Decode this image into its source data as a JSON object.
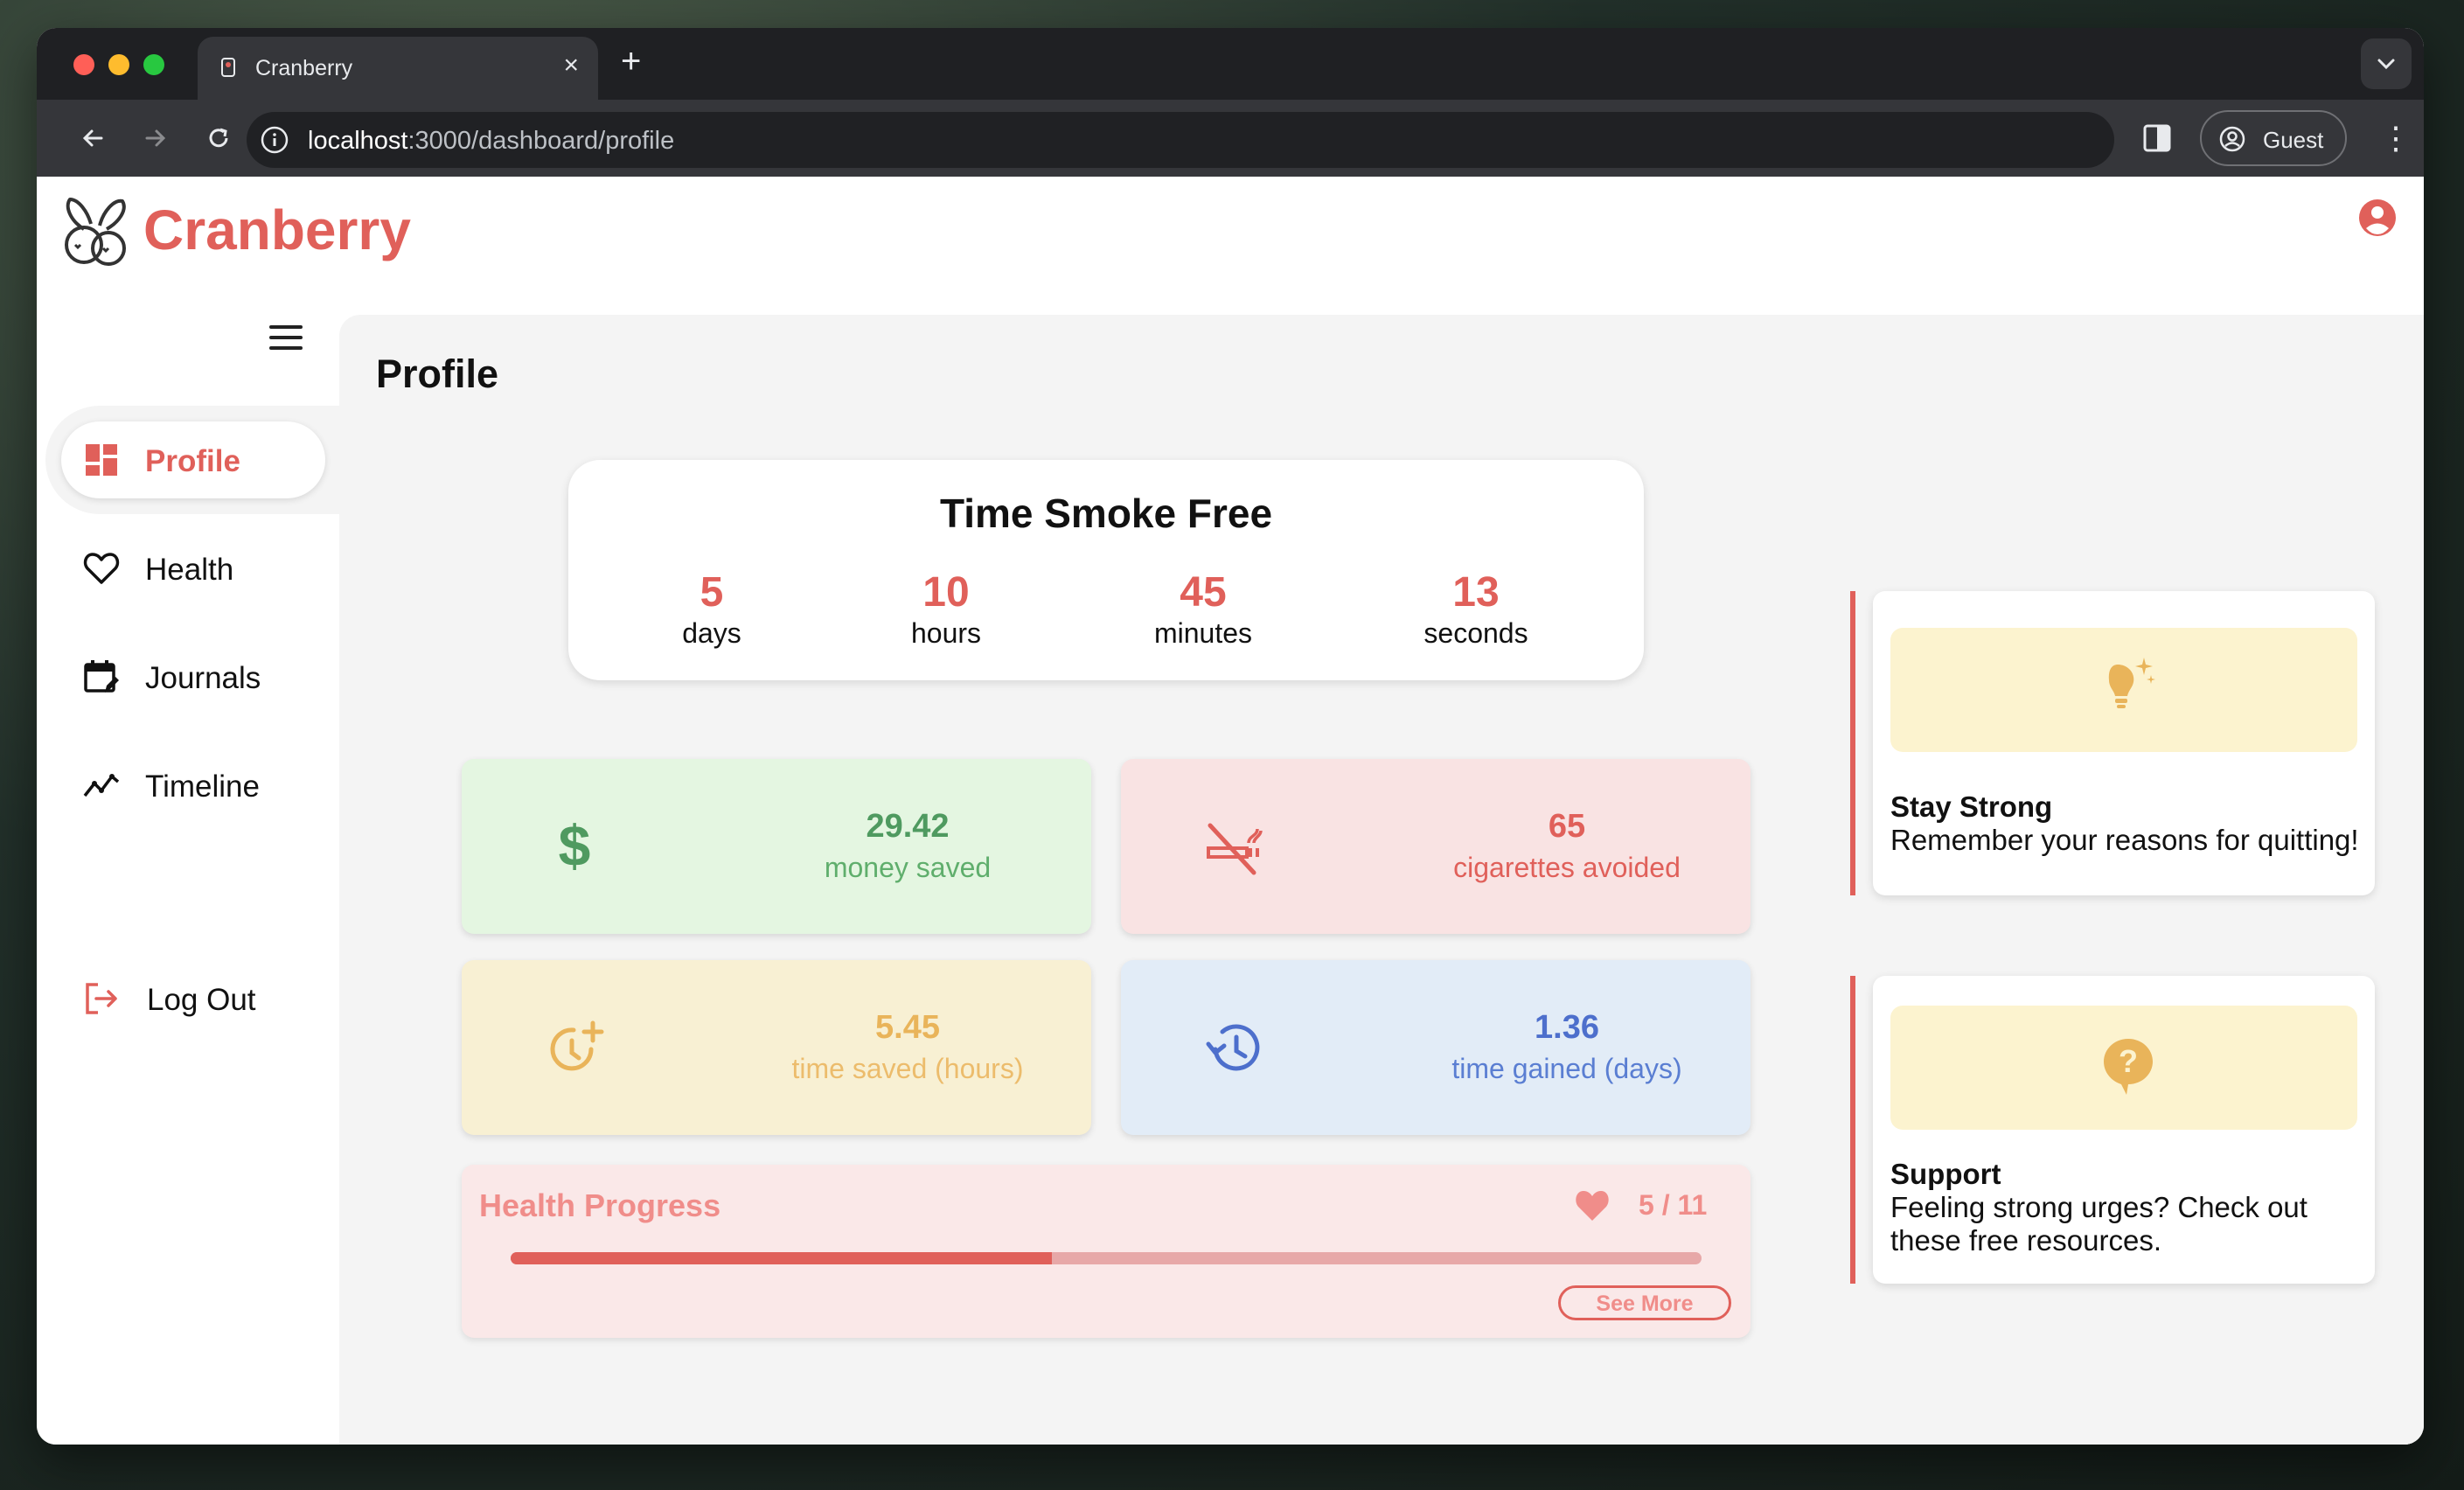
{
  "browser": {
    "tab_title": "Cranberry",
    "url_host": "localhost",
    "url_path": ":3000/dashboard/profile",
    "profile_label": "Guest"
  },
  "app": {
    "brand": "Cranberry",
    "accent_color": "#e0605a"
  },
  "sidebar": {
    "items": [
      {
        "label": "Profile",
        "icon": "dashboard-icon",
        "active": true
      },
      {
        "label": "Health",
        "icon": "heart-icon"
      },
      {
        "label": "Journals",
        "icon": "calendar-edit-icon"
      },
      {
        "label": "Timeline",
        "icon": "trend-line-icon"
      }
    ],
    "logout_label": "Log Out"
  },
  "main": {
    "page_title": "Profile",
    "time_smoke_free": {
      "title": "Time Smoke Free",
      "units": [
        {
          "value": "5",
          "label": "days"
        },
        {
          "value": "10",
          "label": "hours"
        },
        {
          "value": "45",
          "label": "minutes"
        },
        {
          "value": "13",
          "label": "seconds"
        }
      ]
    },
    "stats": [
      {
        "value": "29.42",
        "label": "money saved",
        "icon": "dollar-icon",
        "color": "#4f9a60",
        "bg": "#e4f6e1"
      },
      {
        "value": "65",
        "label": "cigarettes avoided",
        "icon": "no-smoking-icon",
        "color": "#e0605a",
        "bg": "#f9e3e3"
      },
      {
        "value": "5.45",
        "label": "time saved (hours)",
        "icon": "clock-plus-icon",
        "color": "#e9b45a",
        "bg": "#f8f0d3"
      },
      {
        "value": "1.36",
        "label": "time gained (days)",
        "icon": "history-icon",
        "color": "#4d6fcc",
        "bg": "#e2ecf7"
      }
    ],
    "health_progress": {
      "title": "Health Progress",
      "count": "5 / 11",
      "completed": 5,
      "total": 11,
      "button": "See More"
    }
  },
  "tips": [
    {
      "title": "Stay Strong",
      "text": "Remember your reasons for quitting!",
      "icon": "lightbulb-icon"
    },
    {
      "title": "Support",
      "text": "Feeling strong urges? Check out these free resources.",
      "icon": "question-icon"
    }
  ]
}
